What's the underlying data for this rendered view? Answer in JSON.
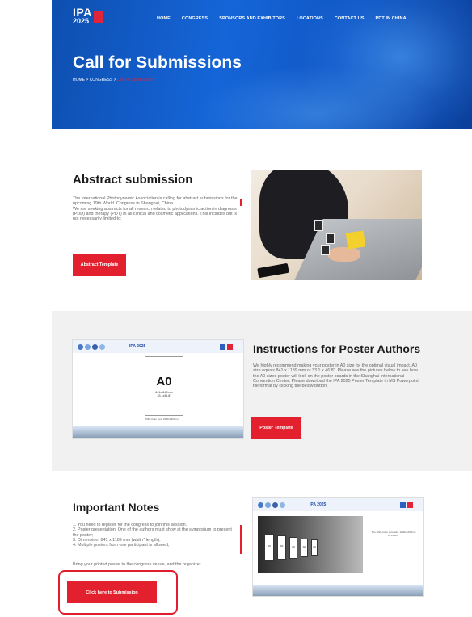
{
  "header": {
    "logo_line1": "IPA",
    "logo_line2": "2025",
    "nav": [
      "HOME",
      "CONGRESS",
      "SPONSORS AND EXHIBITORS",
      "LOCATIONS",
      "CONTACT US",
      "PDT IN CHINA"
    ],
    "page_title": "Call for Submissions",
    "breadcrumb_base": "HOME > CONGRESS > ",
    "breadcrumb_current": "Call for Submissions"
  },
  "abstract": {
    "title": "Abstract submission",
    "body": "The International Photodynamic Association is calling for abstract submissions for the upcoming 19th World. Congress in Shanghai, China.\nWe are seeking abstracts for all research related to photodynamic action in diagnosis (PDD) and therapy (PDT) in all clinical and cosmetic applications. This includes but is not necessarily limited to:",
    "button": "Abstract Template"
  },
  "poster": {
    "title": "Instructions for Poster Authors",
    "body": "We highly recommend making your poster in A0 size for the optimal visual impact. A0 size equals 841 x 1189 mm or 33.1 x 46.8\". Please see the pictures below to see how the A0 sized poster will look on the poster boards in the Shanghai International Convention Center. Please download the IPA 2025 Poster Template in MS Powerpoint file format by clicking the below button.",
    "button": "Poster Template",
    "image_title": "IPA 2025",
    "a0_label": "A0",
    "a0_size": "841x1189mm",
    "a0_inch": "33.1x46.8\"",
    "a0_caption": "White foam core 1500x1200mm"
  },
  "notes": {
    "title": "Important Notes",
    "items": [
      "1. You need to register for the congress to join this session.",
      "2. Poster presentation: One of the authors must show at the symposium to present the poster;",
      "3. Dimension: 841 x 1189 mm (width* length);",
      "4. Multiple posters from one participant is allowed;",
      "Bring your printed poster to the congress venue, and the organizer"
    ],
    "button": "Click here to Submission",
    "image_title": "IPA 2025",
    "board_label": "A0",
    "board_caption": "The white foam core size: 1000x1200mm",
    "board_inch": "33.1x46.8\""
  },
  "colors": {
    "accent_red": "#e3202e",
    "header_blue": "#1565d8"
  }
}
